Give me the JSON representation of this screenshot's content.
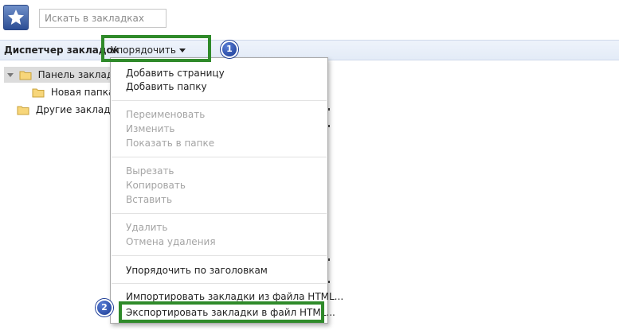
{
  "search": {
    "placeholder": "Искать в закладках"
  },
  "header": {
    "title": "Диспетчер закладок",
    "organize_label": "Упорядочить"
  },
  "tree": {
    "items": [
      {
        "label": "Панель закладок",
        "selected": true
      },
      {
        "label": "Новая папка"
      },
      {
        "label": "Другие закладки"
      }
    ]
  },
  "menu": {
    "items": [
      {
        "label": "Добавить страницу",
        "enabled": true
      },
      {
        "label": "Добавить папку",
        "enabled": true
      },
      {
        "label": "Переименовать",
        "enabled": false
      },
      {
        "label": "Изменить",
        "enabled": false
      },
      {
        "label": "Показать в папке",
        "enabled": false
      },
      {
        "label": "Вырезать",
        "enabled": false
      },
      {
        "label": "Копировать",
        "enabled": false
      },
      {
        "label": "Вставить",
        "enabled": false
      },
      {
        "label": "Удалить",
        "enabled": false
      },
      {
        "label": "Отмена удаления",
        "enabled": false
      },
      {
        "label": "Упорядочить по заголовкам",
        "enabled": true
      },
      {
        "label": "Импортировать закладки из файла HTML...",
        "enabled": true
      },
      {
        "label": "Экспортировать закладки в файл HTML...",
        "enabled": true
      }
    ]
  },
  "annotations": {
    "step1": "1",
    "step2": "2"
  },
  "colors": {
    "highlight": "#2f8a2a",
    "badge": "#1a3a94",
    "header_bg": "#e8eef8",
    "disabled_text": "#a4a4a4"
  },
  "icons": {
    "app": "star-icon",
    "folder": "folder-icon",
    "dropdown": "triangle-down-icon"
  }
}
